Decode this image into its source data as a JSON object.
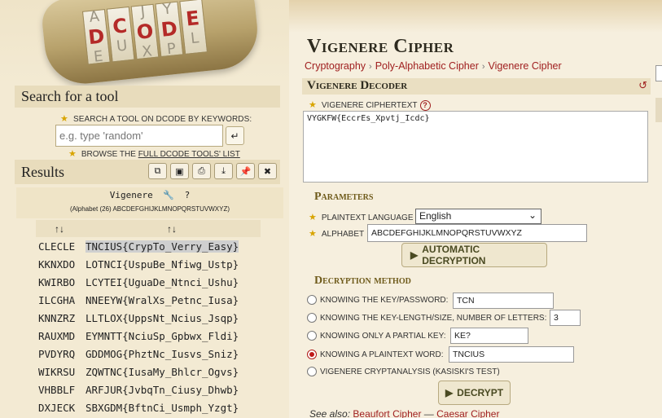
{
  "logo": {
    "cylinder_letters": [
      {
        "top": "A",
        "main": "D",
        "bottom": "E"
      },
      {
        "top": "",
        "main": "C",
        "bottom": "U"
      },
      {
        "top": "J",
        "main": "O",
        "bottom": "X"
      },
      {
        "top": "Y",
        "main": "D",
        "bottom": "P"
      },
      {
        "top": "",
        "main": "E",
        "bottom": "L"
      }
    ]
  },
  "sidebar": {
    "search_title": "Search for a tool",
    "search_hint": "SEARCH A TOOL ON DCODE BY KEYWORDS:",
    "search_placeholder": "e.g. type 'random'",
    "browse_prefix": "BROWSE THE ",
    "browse_link": "FULL DCODE TOOLS' LIST",
    "results_title": "Results",
    "tool_buttons": [
      "copy-icon",
      "save-icon",
      "print-icon",
      "download-icon",
      "pin-icon",
      "close-icon"
    ],
    "vigenere_title": "Vigenere",
    "alphabet_note": "(Alphabet (26) ABCDEFGHIJKLMNOPQRSTUVWXYZ)",
    "columns": [
      "↑↓",
      "↑↓"
    ],
    "results": [
      {
        "key": "CLECLE",
        "text": "TNCIUS{CrypTo_Verry_Easy}"
      },
      {
        "key": "KKNXDO",
        "text": "LOTNCI{UspuBe_Nfiwg_Ustp}"
      },
      {
        "key": "KWIRBO",
        "text": "LCYTEI{UguaDe_Ntnci_Ushu}"
      },
      {
        "key": "ILCGHA",
        "text": "NNEEYW{WralXs_Petnc_Iusa}"
      },
      {
        "key": "KNNZRZ",
        "text": "LLTLOX{UppsNt_Ncius_Jsqp}"
      },
      {
        "key": "RAUXMD",
        "text": "EYMNTT{NciuSp_Gpbwx_Fldi}"
      },
      {
        "key": "PVDYRQ",
        "text": "GDDMOG{PhztNc_Iusvs_Sniz}"
      },
      {
        "key": "WIKRSU",
        "text": "ZQWTNC{IusaMy_Bhlcr_Ogvs}"
      },
      {
        "key": "VHBBLF",
        "text": "ARFJUR{JvbqTn_Ciusy_Dhwb}"
      },
      {
        "key": "DXJECK",
        "text": "SBXGDM{BftnCi_Usmph_Yzgt}"
      }
    ]
  },
  "main": {
    "title": "Vigenere Cipher",
    "breadcrumbs": [
      "Cryptography",
      "Poly-Alphabetic Cipher",
      "Vigenere Cipher"
    ],
    "decoder_title": "Vigenere Decoder",
    "ciphertext_label": "VIGENERE CIPHERTEXT",
    "ciphertext": "VYGKFW{EccrEs_Xpvtj_Icdc}",
    "parameters_title": "Parameters",
    "plaintext_language_label": "PLAINTEXT LANGUAGE",
    "plaintext_language": "English",
    "alphabet_label": "ALPHABET",
    "alphabet": "ABCDEFGHIJKLMNOPQRSTUVWXYZ",
    "auto_button": "AUTOMATIC DECRYPTION",
    "method_title": "Decryption method",
    "methods": [
      {
        "label": "KNOWING THE KEY/PASSWORD:",
        "value": "TCN",
        "selected": false
      },
      {
        "label": "KNOWING THE KEY-LENGTH/SIZE, NUMBER OF LETTERS:",
        "value": "3",
        "selected": false
      },
      {
        "label": "KNOWING ONLY A PARTIAL KEY:",
        "value": "KE?",
        "selected": false
      },
      {
        "label": "KNOWING A PLAINTEXT WORD:",
        "value": "TNCIUS",
        "selected": true
      },
      {
        "label": "VIGENERE CRYPTANALYSIS (KASISKI'S TEST)",
        "value": "",
        "selected": false
      }
    ],
    "decrypt_button": "DECRYPT",
    "see_also_label": "See also:",
    "see_also_links": [
      "Beaufort Cipher",
      "Caesar Cipher"
    ],
    "see_also_sep": " — "
  },
  "colors": {
    "accent_red": "#a02020",
    "header_gold": "#6e5a1a",
    "panel_bg": "#f3ead3"
  }
}
